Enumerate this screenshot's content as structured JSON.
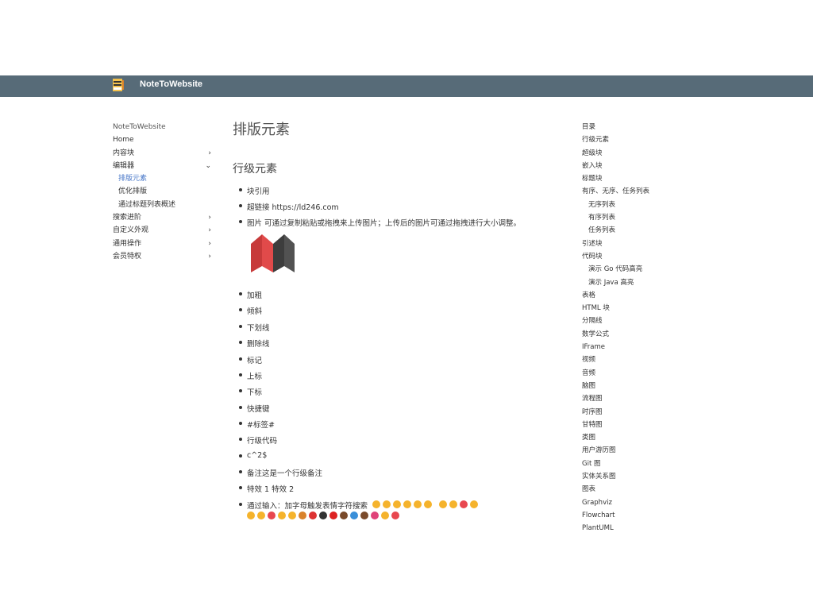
{
  "header": {
    "brand": "NoteToWebsite",
    "logo_icon": "notebook-logo-icon",
    "bg_color": "#576b78"
  },
  "sidebar": {
    "site_name": "NoteToWebsite",
    "items": [
      {
        "label": "Home",
        "chevron": ""
      },
      {
        "label": "内容块",
        "chevron": "›"
      },
      {
        "label": "编辑器",
        "chevron": "⌄"
      },
      {
        "label": "排版元素",
        "sub": true,
        "active": true
      },
      {
        "label": "优化排版",
        "sub": true
      },
      {
        "label": "通过标题列表概述",
        "sub": true
      },
      {
        "label": "搜索进阶",
        "chevron": "›"
      },
      {
        "label": "自定义外观",
        "chevron": "›"
      },
      {
        "label": "通用操作",
        "chevron": "›"
      },
      {
        "label": "会员特权",
        "chevron": "›"
      }
    ]
  },
  "main": {
    "title": "排版元素",
    "section_title": "行级元素",
    "list": [
      "块引用",
      "超链接 https://ld246.com",
      "图片 可通过复制粘贴或拖拽来上传图片；上传后的图片可通过拖拽进行大小调整。",
      "加粗",
      "倾斜",
      "下划线",
      "删除线",
      "标记",
      "上标",
      "下标",
      "快捷键",
      " #标签#",
      "行级代码",
      "c^2$",
      "备注这是一个行级备注",
      "特效 1 特效 2",
      "通过输入：加字母触发表情字符搜索"
    ],
    "image_icon": "m-logo-image"
  },
  "toc": {
    "items": [
      {
        "label": "目录"
      },
      {
        "label": "行级元素"
      },
      {
        "label": "超级块"
      },
      {
        "label": "嵌入块"
      },
      {
        "label": "标题块"
      },
      {
        "label": "有序、无序、任务列表"
      },
      {
        "label": "无序列表",
        "sub": true
      },
      {
        "label": "有序列表",
        "sub": true
      },
      {
        "label": "任务列表",
        "sub": true
      },
      {
        "label": "引述块"
      },
      {
        "label": "代码块"
      },
      {
        "label": "演示 Go 代码高亮",
        "sub": true
      },
      {
        "label": "演示 Java 高亮",
        "sub": true
      },
      {
        "label": "表格"
      },
      {
        "label": "HTML 块"
      },
      {
        "label": "分隔线"
      },
      {
        "label": "数学公式"
      },
      {
        "label": "IFrame"
      },
      {
        "label": "视频"
      },
      {
        "label": "音频"
      },
      {
        "label": "脑图"
      },
      {
        "label": "流程图"
      },
      {
        "label": "时序图"
      },
      {
        "label": "甘特图"
      },
      {
        "label": "类图"
      },
      {
        "label": "用户游历图"
      },
      {
        "label": "Git 图"
      },
      {
        "label": "实体关系图"
      },
      {
        "label": "图表"
      },
      {
        "label": "Graphviz"
      },
      {
        "label": "Flowchart"
      },
      {
        "label": "PlantUML"
      }
    ]
  }
}
